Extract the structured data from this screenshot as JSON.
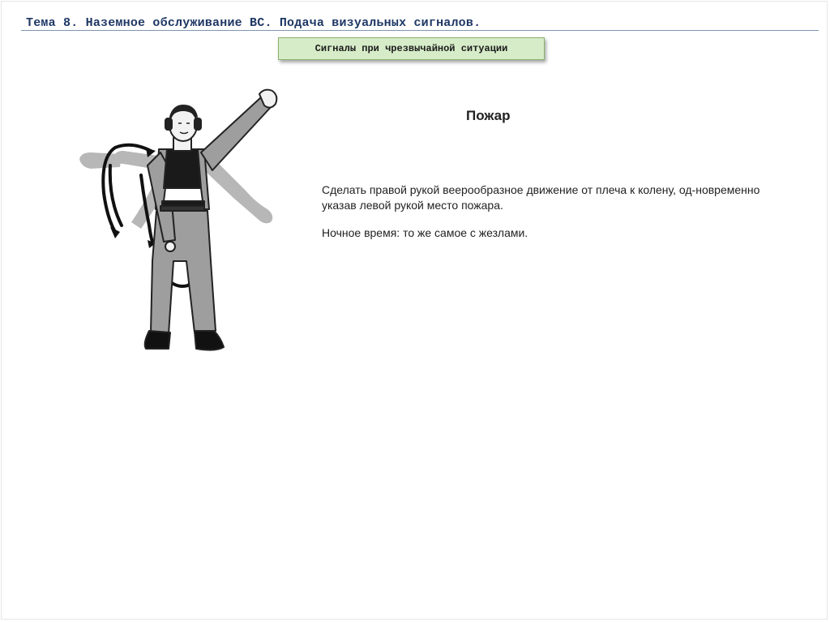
{
  "header": {
    "title": "Тема 8. Наземное обслуживание ВС. Подача визуальных сигналов."
  },
  "section": {
    "label": "Сигналы при чрезвычайной ситуации"
  },
  "signal": {
    "title": "Пожар",
    "description": "Сделать правой рукой веерообразное движение от плеча к колену, од-новременно указав левой рукой  место пожара.",
    "night_note": "Ночное время: то же самое с жезлами."
  },
  "figure": {
    "icon": "marshaller-fire-signal-icon",
    "colors": {
      "suit": "#9e9e9e",
      "vest": "#1a1a1a",
      "ghost_arm": "#b7b7b7",
      "skin": "#f2f2f2"
    }
  }
}
